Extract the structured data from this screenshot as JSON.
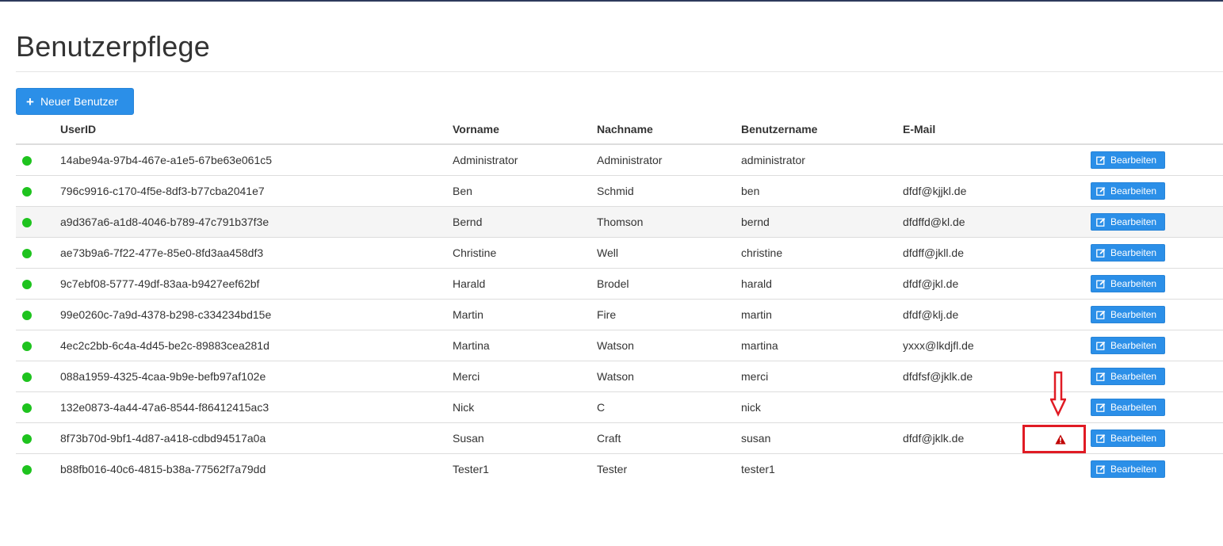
{
  "page": {
    "title": "Benutzerpflege",
    "new_user_label": "Neuer Benutzer"
  },
  "table": {
    "headers": {
      "userid": "UserID",
      "vorname": "Vorname",
      "nachname": "Nachname",
      "benutzername": "Benutzername",
      "email": "E-Mail"
    },
    "edit_label": "Bearbeiten",
    "rows": [
      {
        "userid": "14abe94a-97b4-467e-a1e5-67be63e061c5",
        "vorname": "Administrator",
        "nachname": "Administrator",
        "benutzername": "administrator",
        "email": "",
        "warning": false
      },
      {
        "userid": "796c9916-c170-4f5e-8df3-b77cba2041e7",
        "vorname": "Ben",
        "nachname": "Schmid",
        "benutzername": "ben",
        "email": "dfdf@kjjkl.de",
        "warning": false
      },
      {
        "userid": "a9d367a6-a1d8-4046-b789-47c791b37f3e",
        "vorname": "Bernd",
        "nachname": "Thomson",
        "benutzername": "bernd",
        "email": "dfdffd@kl.de",
        "warning": false
      },
      {
        "userid": "ae73b9a6-7f22-477e-85e0-8fd3aa458df3",
        "vorname": "Christine",
        "nachname": "Well",
        "benutzername": "christine",
        "email": "dfdff@jkll.de",
        "warning": false
      },
      {
        "userid": "9c7ebf08-5777-49df-83aa-b9427eef62bf",
        "vorname": "Harald",
        "nachname": "Brodel",
        "benutzername": "harald",
        "email": "dfdf@jkl.de",
        "warning": false
      },
      {
        "userid": "99e0260c-7a9d-4378-b298-c334234bd15e",
        "vorname": "Martin",
        "nachname": "Fire",
        "benutzername": "martin",
        "email": "dfdf@klj.de",
        "warning": false
      },
      {
        "userid": "4ec2c2bb-6c4a-4d45-be2c-89883cea281d",
        "vorname": "Martina",
        "nachname": "Watson",
        "benutzername": "martina",
        "email": "yxxx@lkdjfl.de",
        "warning": false
      },
      {
        "userid": "088a1959-4325-4caa-9b9e-befb97af102e",
        "vorname": "Merci",
        "nachname": "Watson",
        "benutzername": "merci",
        "email": "dfdfsf@jklk.de",
        "warning": false
      },
      {
        "userid": "132e0873-4a44-47a6-8544-f86412415ac3",
        "vorname": "Nick",
        "nachname": "C",
        "benutzername": "nick",
        "email": "",
        "warning": false
      },
      {
        "userid": "8f73b70d-9bf1-4d87-a418-cdbd94517a0a",
        "vorname": "Susan",
        "nachname": "Craft",
        "benutzername": "susan",
        "email": "dfdf@jklk.de",
        "warning": true
      },
      {
        "userid": "b88fb016-40c6-4815-b38a-77562f7a79dd",
        "vorname": "Tester1",
        "nachname": "Tester",
        "benutzername": "tester1",
        "email": "",
        "warning": false
      }
    ]
  },
  "colors": {
    "primary": "#2b8fe8",
    "status_active": "#1ec31e",
    "warning": "#c00000",
    "annotation": "#e01b24"
  }
}
